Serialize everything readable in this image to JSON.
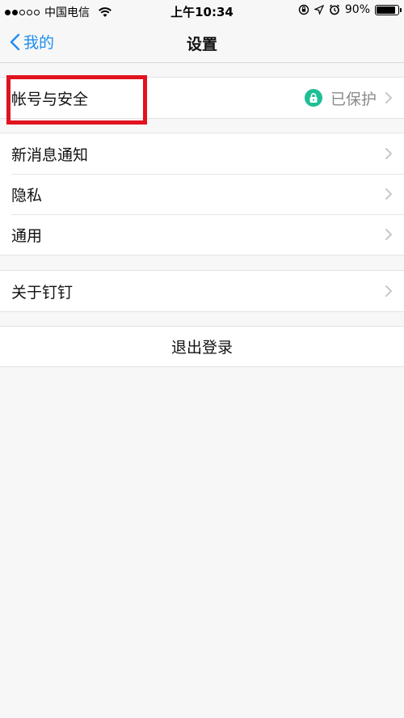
{
  "status_bar": {
    "carrier": "中国电信",
    "time": "上午10:34",
    "battery_percent": "90%",
    "battery_level": 0.9
  },
  "nav": {
    "back_label": "我的",
    "title": "设置"
  },
  "groups": [
    {
      "rows": [
        {
          "label": "帐号与安全",
          "value": "已保护",
          "icon": "lock-icon",
          "highlighted": true
        }
      ]
    },
    {
      "rows": [
        {
          "label": "新消息通知"
        },
        {
          "label": "隐私"
        },
        {
          "label": "通用"
        }
      ]
    },
    {
      "rows": [
        {
          "label": "关于钉钉"
        }
      ]
    }
  ],
  "logout_label": "退出登录",
  "colors": {
    "accent": "#1e8ef0",
    "lock_badge": "#1fbf95",
    "highlight": "#e0131f"
  }
}
